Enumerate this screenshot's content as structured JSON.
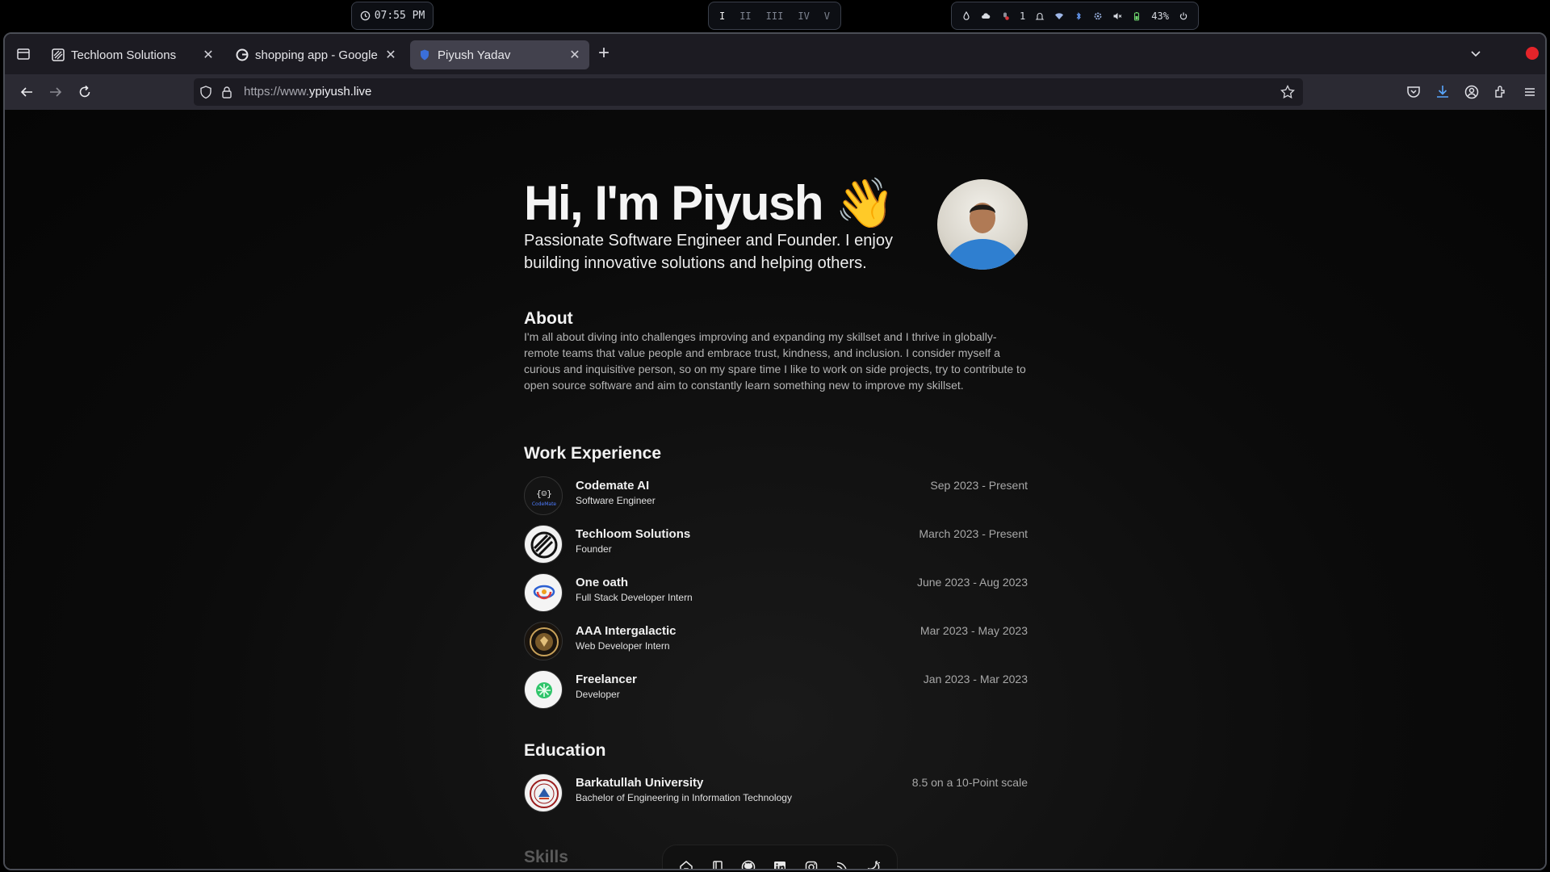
{
  "system_bar": {
    "clock": "07:55 PM",
    "workspaces": [
      "I",
      "II",
      "III",
      "IV",
      "V"
    ],
    "tray": {
      "notification_count": "1",
      "battery": "43%"
    }
  },
  "browser": {
    "tabs": [
      {
        "title": "Techloom Solutions",
        "active": false
      },
      {
        "title": "shopping app - Google Se",
        "active": false
      },
      {
        "title": "Piyush Yadav",
        "active": true
      }
    ],
    "new_tab_label": "+",
    "url_prefix": "https://www.",
    "url_domain": "ypiyush.live"
  },
  "hero": {
    "title": "Hi, I'm Piyush 👋",
    "subtitle": "Passionate Software Engineer and Founder. I enjoy building innovative solutions and helping others."
  },
  "about": {
    "heading": "About",
    "text": "I'm all about diving into challenges improving and expanding my skillset and I thrive in globally-remote teams that value people and embrace trust, kindness, and inclusion. I consider myself a curious and inquisitive person, so on my spare time I like to work on side projects, try to contribute to open source software and aim to constantly learn something new to improve my skillset."
  },
  "work": {
    "heading": "Work Experience",
    "items": [
      {
        "name": "Codemate AI",
        "role": "Software Engineer",
        "date": "Sep 2023 - Present"
      },
      {
        "name": "Techloom Solutions",
        "role": "Founder",
        "date": "March 2023 - Present"
      },
      {
        "name": "One oath",
        "role": "Full Stack Developer Intern",
        "date": "June 2023 - Aug 2023"
      },
      {
        "name": "AAA Intergalactic",
        "role": "Web Developer Intern",
        "date": "Mar 2023 - May 2023"
      },
      {
        "name": "Freelancer",
        "role": "Developer",
        "date": "Jan 2023 - Mar 2023"
      }
    ]
  },
  "education": {
    "heading": "Education",
    "items": [
      {
        "name": "Barkatullah University",
        "role": "Bachelor of Engineering in Information Technology",
        "date": "8.5 on a 10-Point scale"
      }
    ]
  },
  "skills": {
    "heading": "Skills"
  },
  "dock": [
    "home-icon",
    "notebook-icon",
    "github-icon",
    "linkedin-icon",
    "instagram-icon",
    "rss-icon",
    "theme-toggle-icon"
  ]
}
